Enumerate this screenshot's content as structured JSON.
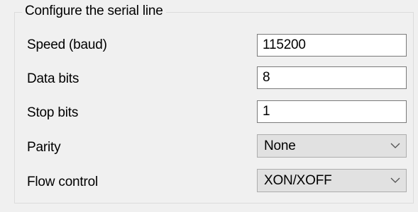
{
  "group": {
    "title": "Configure the serial line"
  },
  "fields": {
    "speed": {
      "label": "Speed (baud)",
      "value": "115200"
    },
    "data_bits": {
      "label": "Data bits",
      "value": "8"
    },
    "stop_bits": {
      "label": "Stop bits",
      "value": "1"
    },
    "parity": {
      "label": "Parity",
      "value": "None"
    },
    "flow_control": {
      "label": "Flow control",
      "value": "XON/XOFF"
    }
  },
  "icons": {
    "dropdown": "chevron-down-icon"
  },
  "colors": {
    "background": "#f0f0f0",
    "group_border": "#dcdcdc",
    "textbox_border": "#7a7a7a",
    "combobox_fill": "#e1e1e1",
    "combobox_border": "#adadad"
  }
}
